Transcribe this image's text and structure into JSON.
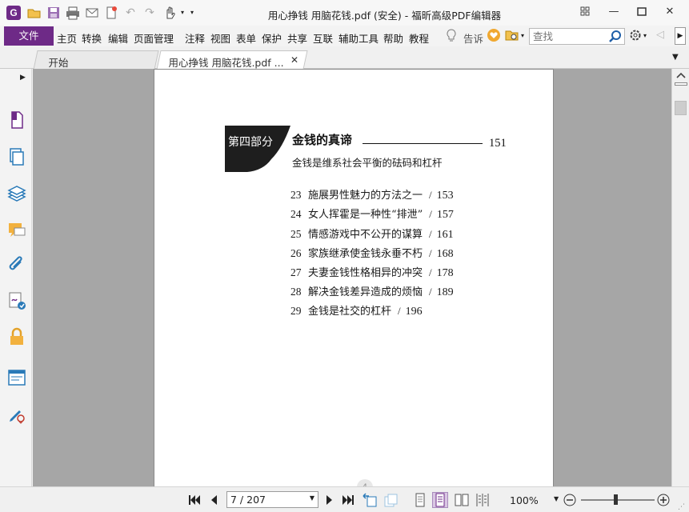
{
  "window": {
    "title": "用心挣钱 用脑花钱.pdf (安全) - 福昕高级PDF编辑器",
    "app_logo": "G"
  },
  "menu": {
    "file": "文件",
    "items": [
      "主页",
      "转换",
      "编辑",
      "页面管理",
      "注释",
      "视图",
      "表单",
      "保护",
      "共享",
      "互联",
      "辅助工具",
      "帮助",
      "教程"
    ],
    "tell": "告诉",
    "search_placeholder": "查找"
  },
  "tabs": [
    {
      "label": "开始"
    },
    {
      "label": "用心挣钱 用脑花钱.pdf ...",
      "active": true
    }
  ],
  "document": {
    "part_label": "第四部分",
    "section_title": "金钱的真谛",
    "section_page": "151",
    "section_subtitle": "金钱是维系社会平衡的砝码和杠杆",
    "toc": [
      {
        "num": "23",
        "title": "施展男性魅力的方法之一",
        "page": "153"
      },
      {
        "num": "24",
        "title": "女人挥霍是一种性“排泄”",
        "page": "157"
      },
      {
        "num": "25",
        "title": "情感游戏中不公开的谋算",
        "page": "161"
      },
      {
        "num": "26",
        "title": "家族继承使金钱永垂不朽",
        "page": "168"
      },
      {
        "num": "27",
        "title": "夫妻金钱性格相异的冲突",
        "page": "178"
      },
      {
        "num": "28",
        "title": "解决金钱差异造成的烦恼",
        "page": "189"
      },
      {
        "num": "29",
        "title": "金钱是社交的杠杆",
        "page": "196"
      }
    ],
    "toc_separator": "/",
    "page_marker": "4"
  },
  "status": {
    "page_indicator": "7 / 207",
    "zoom": "100%",
    "zoom_level_fraction": 0.45
  },
  "colors": {
    "accent": "#6e2a87",
    "doc_background": "#a6a6a6",
    "active_view": "#d9c6e3"
  }
}
